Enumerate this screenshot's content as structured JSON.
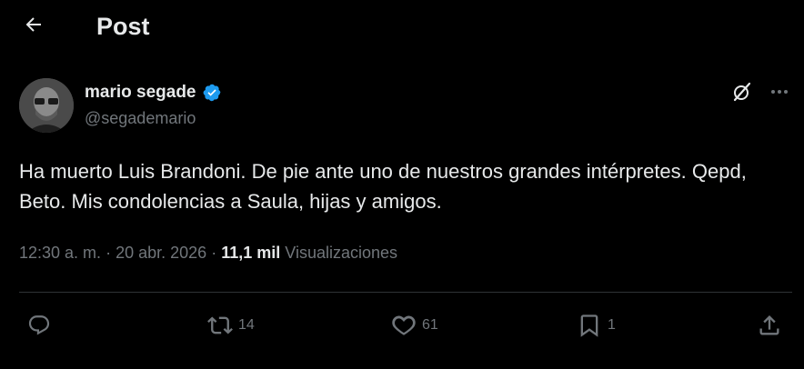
{
  "header": {
    "title": "Post",
    "back_icon": "arrow-left-icon"
  },
  "author": {
    "name": "mario segade",
    "handle": "@segademario",
    "verified": true,
    "verified_color": "#1d9bf0"
  },
  "post": {
    "text": "Ha muerto Luis Brandoni. De pie ante uno de nuestros grandes intérpretes. Qepd, Beto. Mis condolencias a Saula, hijas y amigos.",
    "time": "12:30 a. m.",
    "separator": "·",
    "date": "20 abr. 2026",
    "views_count": "11,1 mil",
    "views_label": "Visualizaciones"
  },
  "actions": {
    "reply_count": "",
    "repost_count": "14",
    "like_count": "61",
    "bookmark_count": "1"
  },
  "colors": {
    "background": "#000000",
    "text": "#e7e9ea",
    "muted": "#71767b",
    "divider": "#2f3336"
  }
}
